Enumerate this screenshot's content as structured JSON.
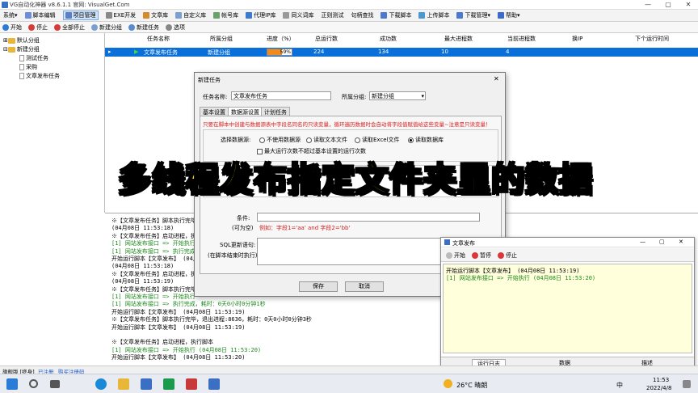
{
  "window": {
    "title": "VG自动化神器 v8.6.1.1   官网: VisualGet.Com",
    "controls": [
      "—",
      "▢",
      "✕"
    ]
  },
  "menubar": [
    {
      "label": "系统",
      "arrow": "▾",
      "color": ""
    },
    {
      "label": "脚本编辑",
      "color": "#6a8fd8"
    },
    {
      "label": "项目管理",
      "color": "#5a7fc8",
      "active": true
    },
    {
      "label": "EXE开发",
      "color": "#888888"
    },
    {
      "label": "文章库",
      "color": "#d68a2a"
    },
    {
      "label": "自定义库",
      "color": "#7aa0d0"
    },
    {
      "label": "帐号库",
      "color": "#6aa06a"
    },
    {
      "label": "代理IP库",
      "color": "#3a7ad0"
    },
    {
      "label": "同义词库",
      "color": "#999999"
    },
    {
      "label": "正则测试",
      "color": ""
    },
    {
      "label": "句柄查找",
      "color": ""
    },
    {
      "label": "下载脚本",
      "color": "#4a7ad0"
    },
    {
      "label": "上传脚本",
      "color": "#4a9ad0"
    },
    {
      "label": "下载管理",
      "color": "#4a7ad0",
      "arrow": "▾"
    },
    {
      "label": "帮助",
      "color": "#3a6ad0",
      "arrow": "▾"
    }
  ],
  "toolbar": [
    {
      "label": "开始",
      "color": "#2a7ad8"
    },
    {
      "label": "停止",
      "color": "#d83a3a"
    },
    {
      "label": "全部停止",
      "color": "#d83a3a"
    },
    {
      "label": "新建分组",
      "color": "#7aa0d0"
    },
    {
      "label": "新建任务",
      "color": "#5a8ad0"
    },
    {
      "label": "选项",
      "color": "#888888"
    }
  ],
  "tree": {
    "items": [
      {
        "label": "默认分组",
        "type": "folder",
        "expander": "⊞"
      },
      {
        "label": "新建分组",
        "type": "folder",
        "expander": "⊟"
      },
      {
        "label": "测试任务",
        "type": "page"
      },
      {
        "label": "采购",
        "type": "page"
      },
      {
        "label": "文章发布任务",
        "type": "page"
      }
    ]
  },
  "grid": {
    "headers": [
      "任务名称",
      "所属分组",
      "进度（%）",
      "总运行数",
      "成功数",
      "最大进程数",
      "当前进程数",
      "换IP",
      "下个运行时间"
    ],
    "row": {
      "name": "文章发布任务",
      "group": "新建分组",
      "progress": "59%",
      "progress_value": 0.59,
      "total": "224",
      "success": "134",
      "maxproc": "10",
      "curproc": "4",
      "changeip": "",
      "next": ""
    }
  },
  "log": {
    "lines": [
      {
        "text": "※【文章发布任务】脚本执行完毕",
        "cls": ""
      },
      {
        "text": "(04月08日 11:53:18)",
        "cls": ""
      },
      {
        "text": "※【文章发布任务】启动进程，执",
        "cls": ""
      },
      {
        "text": "[1] 网站发布接口 => 开始执行",
        "cls": "green"
      },
      {
        "text": "[1] 网站发布接口 => 执行完成",
        "cls": "green"
      },
      {
        "text": "开始运行脚本【文章发布】 (04月",
        "cls": ""
      },
      {
        "text": "(04月08日 11:53:18)",
        "cls": ""
      },
      {
        "text": "※【文章发布任务】启动进程，执",
        "cls": ""
      },
      {
        "text": "(04月08日 11:53:19)",
        "cls": ""
      },
      {
        "text": "※【文章发布任务】脚本执行完毕",
        "cls": ""
      },
      {
        "text": "[1] 网站发布接口 => 开始执行",
        "cls": "green"
      },
      {
        "text": "[1] 网站发布接口 => 执行完成，耗时：0天0小时0分钟1秒",
        "cls": "green"
      },
      {
        "text": "开始运行脚本【文章发布】 (04月08日 11:53:19)",
        "cls": ""
      },
      {
        "text": "※【文章发布任务】脚本执行完毕，退出进程:8636，耗时：0天0小时0分钟3秒",
        "cls": ""
      },
      {
        "text": "开始运行脚本【文章发布】 (04月08日 11:53:19)",
        "cls": ""
      },
      {
        "text": "",
        "cls": ""
      },
      {
        "text": "※【文章发布任务】启动进程，执行脚本",
        "cls": ""
      },
      {
        "text": "[1] 网站发布接口 => 开始执行 (04月08日 11:53:20)",
        "cls": "green"
      },
      {
        "text": "开始运行脚本【文章发布】 (04月08日 11:53:20)",
        "cls": ""
      }
    ]
  },
  "dialog": {
    "title": "新建任务",
    "close": "✕",
    "name_label": "任务名称:",
    "name_value": "文章发布任务",
    "group_label": "所属分组:",
    "group_value": "新建分组",
    "tabs": [
      "基本设置",
      "数据源设置",
      "计划任务"
    ],
    "notice": "只要在脚本中创建与数据源表中字段名同名的只读变量，循环遍历数据时会自动将字段值赋值给这些变量~注意是只读变量！",
    "source_label": "选择数据源:",
    "sources": [
      "不使用数据源",
      "读取文本文件",
      "读取Excel文件",
      "读取数据库"
    ],
    "selected_source": 3,
    "limit_check": "最大运行次数不超过基本设置的运行次数",
    "cond_label": "条件:",
    "cond_hint_label": "(可为空)",
    "cond_example": "例如：字段1='aa' and 字段2='bb'",
    "sql_label": "SQL更新语句:",
    "sql_hint": "(在脚本结束时执行)",
    "save": "保存",
    "cancel": "取消"
  },
  "banner": {
    "text": "多线程发布指定文件夹里的数据"
  },
  "pub": {
    "title": "文章发布",
    "controls": [
      "—",
      "▢",
      "✕"
    ],
    "buttons": [
      {
        "label": "开始",
        "color": "#bbbbbb"
      },
      {
        "label": "暂停",
        "color": "#d83a3a"
      },
      {
        "label": "停止",
        "color": "#d83a3a"
      }
    ],
    "lines": [
      {
        "text": "开始运行脚本【文章发布】 (04月08日 11:53:19)",
        "cls": ""
      },
      {
        "text": "[1] 网站发布接口 => 开始执行 (04月08日 11:53:20)",
        "cls": "green"
      }
    ],
    "tabs": [
      "运行日志",
      "数据",
      "描述"
    ]
  },
  "statusbar": {
    "edition": "旗舰版 [终身]",
    "registered": "已注册",
    "link": "购买注册码"
  },
  "taskbar": {
    "weather": "26°C  晴朗",
    "lang": "中",
    "time": "11:53",
    "date": "2022/4/8"
  }
}
